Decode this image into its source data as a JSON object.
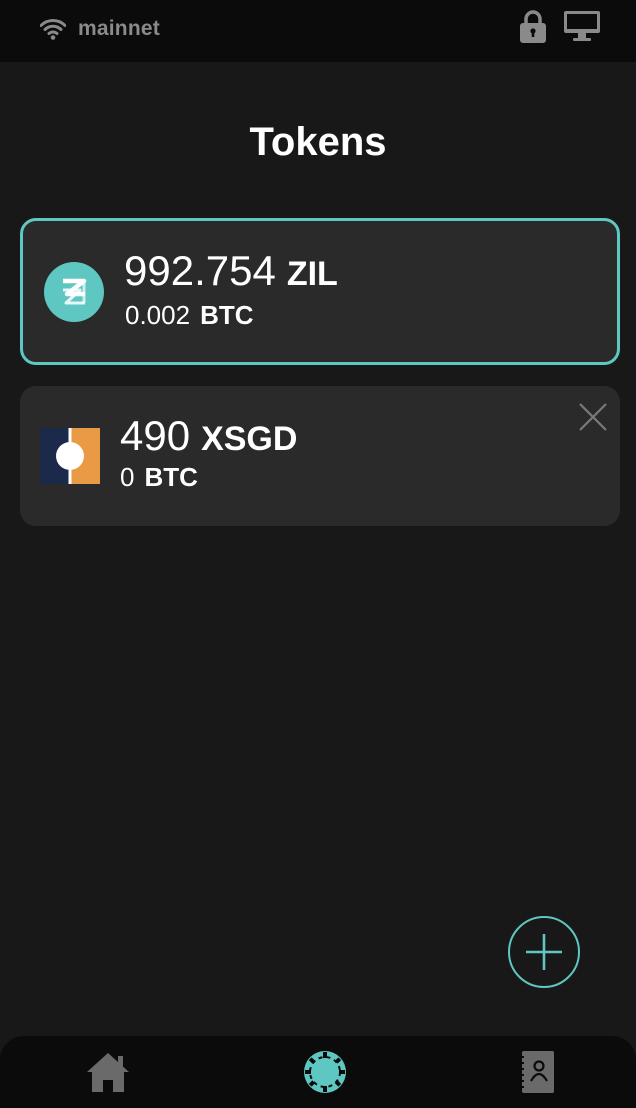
{
  "status_bar": {
    "network_label": "mainnet",
    "icons": [
      "wifi-icon",
      "lock-icon",
      "monitor-icon"
    ]
  },
  "page": {
    "title": "Tokens"
  },
  "tokens": [
    {
      "amount": "992.754",
      "symbol": "ZIL",
      "fiat_amount": "0.002",
      "fiat_symbol": "BTC",
      "icon": "zil-logo-icon",
      "selected": true
    },
    {
      "amount": "490",
      "symbol": "XSGD",
      "fiat_amount": "0",
      "fiat_symbol": "BTC",
      "icon": "xsgd-logo-icon",
      "selected": false,
      "removable": true
    }
  ],
  "actions": {
    "add_token_icon": "plus-icon"
  },
  "bottom_nav": {
    "items": [
      {
        "icon": "home-icon",
        "active": false
      },
      {
        "icon": "tokens-icon",
        "active": true
      },
      {
        "icon": "contacts-icon",
        "active": false
      }
    ]
  },
  "colors": {
    "accent": "#5ec7c2",
    "background": "#181818",
    "card": "#2a2a2a",
    "bar": "#0b0b0b",
    "muted": "#8a8a8a",
    "xsgd_navy": "#1b2a4a",
    "xsgd_orange": "#ea9a44"
  }
}
